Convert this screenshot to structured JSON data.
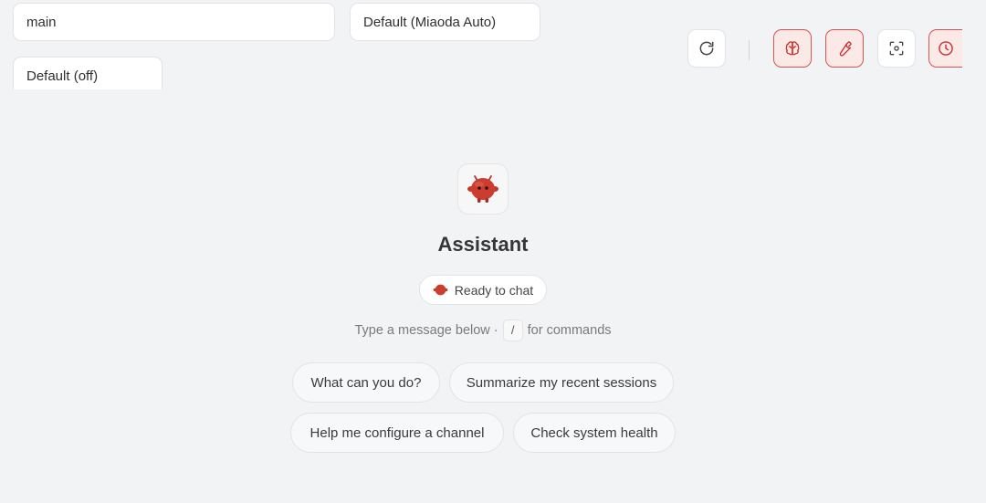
{
  "header": {
    "session_value": "main",
    "model_value": "Default (Miaoda Auto)",
    "thinking_value": "Default (off)"
  },
  "toolbar": {
    "buttons": [
      {
        "icon": "refresh-icon",
        "active": false
      },
      {
        "icon": "brain-icon",
        "active": true
      },
      {
        "icon": "wrench-icon",
        "active": true
      },
      {
        "icon": "focus-icon",
        "active": false
      },
      {
        "icon": "clock-icon",
        "active": true
      }
    ],
    "accent_color": "#d9534f"
  },
  "welcome": {
    "mascot_icon": "red-mascot-icon",
    "title": "Assistant",
    "status": "Ready to chat",
    "hint_before": "Type a message below ·",
    "hint_key": "/",
    "hint_after": "for commands"
  },
  "suggestions": [
    "What can you do?",
    "Summarize my recent sessions",
    "Help me configure a channel",
    "Check system health"
  ]
}
